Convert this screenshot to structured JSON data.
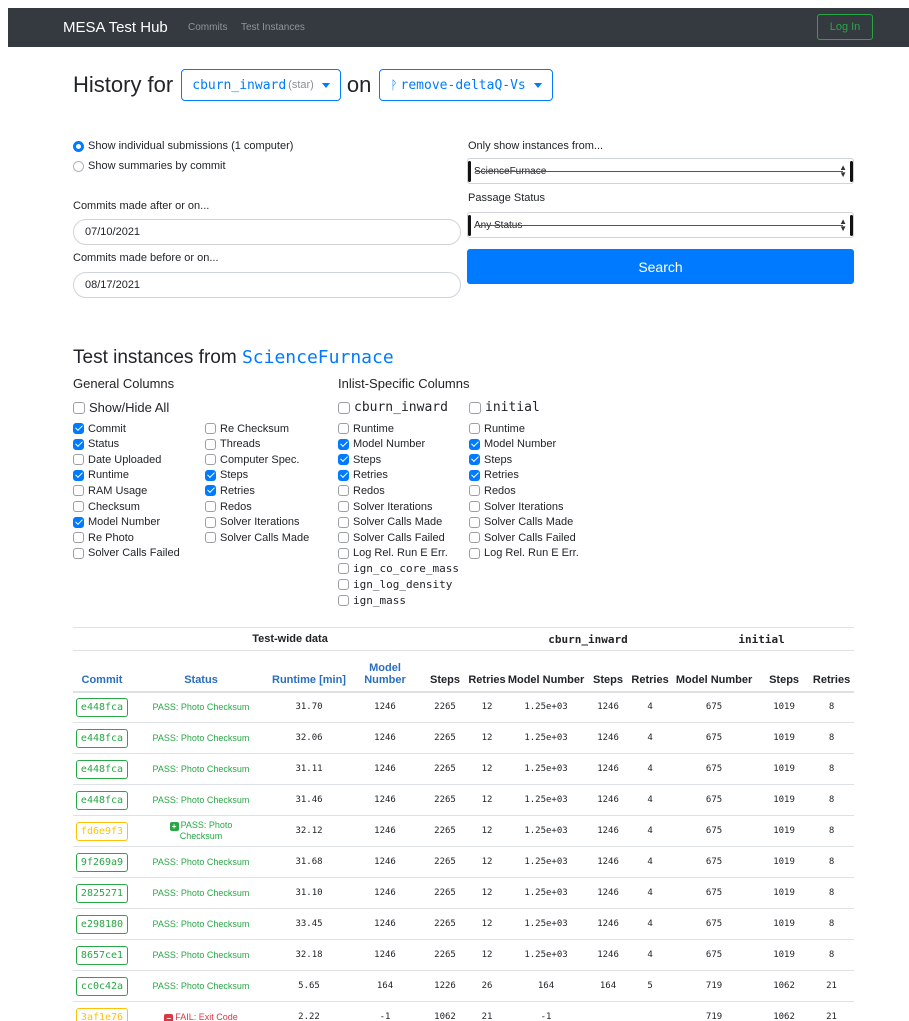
{
  "nav": {
    "brand": "MESA Test Hub",
    "links": [
      "Commits",
      "Test Instances"
    ],
    "login": "Log In"
  },
  "history": {
    "prefix": "History for",
    "test": "cburn_inward",
    "test_sub": "(star)",
    "on": "on",
    "branch": "remove-deltaQ-Vs"
  },
  "form": {
    "radio1": "Show individual submissions (1 computer)",
    "radio2": "Show summaries by commit",
    "after_label": "Commits made after or on...",
    "after_value": "07/10/2021",
    "before_label": "Commits made before or on...",
    "before_value": "08/17/2021",
    "instances_label": "Only show instances from...",
    "instances_value": "ScienceFurnace",
    "status_label": "Passage Status",
    "status_value": "Any Status",
    "search": "Search"
  },
  "instances": {
    "title": "Test instances from",
    "computer": "ScienceFurnace",
    "general_title": "General Columns",
    "inlist_title": "Inlist-Specific Columns",
    "show_hide": "Show/Hide All",
    "general_left": [
      {
        "label": "Commit",
        "checked": true
      },
      {
        "label": "Status",
        "checked": true
      },
      {
        "label": "Date Uploaded",
        "checked": false
      },
      {
        "label": "Runtime",
        "checked": true
      },
      {
        "label": "RAM Usage",
        "checked": false
      },
      {
        "label": "Checksum",
        "checked": false
      },
      {
        "label": "Model Number",
        "checked": true
      },
      {
        "label": "Re Photo",
        "checked": false
      },
      {
        "label": "Solver Calls Failed",
        "checked": false
      }
    ],
    "general_right": [
      {
        "label": "Re Checksum",
        "checked": false
      },
      {
        "label": "Threads",
        "checked": false
      },
      {
        "label": "Computer Spec.",
        "checked": false
      },
      {
        "label": "Steps",
        "checked": true
      },
      {
        "label": "Retries",
        "checked": true
      },
      {
        "label": "Redos",
        "checked": false
      },
      {
        "label": "Solver Iterations",
        "checked": false
      },
      {
        "label": "Solver Calls Made",
        "checked": false
      }
    ],
    "inlist1_name": "cburn_inward",
    "inlist1": [
      {
        "label": "Runtime",
        "checked": false
      },
      {
        "label": "Model Number",
        "checked": true
      },
      {
        "label": "Steps",
        "checked": true
      },
      {
        "label": "Retries",
        "checked": true
      },
      {
        "label": "Redos",
        "checked": false
      },
      {
        "label": "Solver Iterations",
        "checked": false
      },
      {
        "label": "Solver Calls Made",
        "checked": false
      },
      {
        "label": "Solver Calls Failed",
        "checked": false
      },
      {
        "label": "Log Rel. Run E Err.",
        "checked": false
      },
      {
        "label": "ign_co_core_mass",
        "checked": false,
        "mono": true
      },
      {
        "label": "ign_log_density",
        "checked": false,
        "mono": true
      },
      {
        "label": "ign_mass",
        "checked": false,
        "mono": true
      }
    ],
    "inlist2_name": "initial",
    "inlist2": [
      {
        "label": "Runtime",
        "checked": false
      },
      {
        "label": "Model Number",
        "checked": true
      },
      {
        "label": "Steps",
        "checked": true
      },
      {
        "label": "Retries",
        "checked": true
      },
      {
        "label": "Redos",
        "checked": false
      },
      {
        "label": "Solver Iterations",
        "checked": false
      },
      {
        "label": "Solver Calls Made",
        "checked": false
      },
      {
        "label": "Solver Calls Failed",
        "checked": false
      },
      {
        "label": "Log Rel. Run E Err.",
        "checked": false
      }
    ]
  },
  "table": {
    "groups": [
      "Test-wide data",
      "cburn_inward",
      "initial"
    ],
    "headers": [
      "Commit",
      "Status",
      "Runtime [min]",
      "Model Number",
      "Steps",
      "Retries",
      "Model Number",
      "Steps",
      "Retries",
      "Model Number",
      "Steps",
      "Retries"
    ],
    "rows": [
      {
        "commit": "e448fca",
        "state": "pass",
        "status": "PASS: Photo Checksum",
        "icon": false,
        "cells": [
          "31.70",
          "1246",
          "2265",
          "12",
          "1.25e+03",
          "1246",
          "4",
          "675",
          "1019",
          "8"
        ]
      },
      {
        "commit": "e448fca",
        "state": "pass",
        "status": "PASS: Photo Checksum",
        "icon": false,
        "cells": [
          "32.06",
          "1246",
          "2265",
          "12",
          "1.25e+03",
          "1246",
          "4",
          "675",
          "1019",
          "8"
        ]
      },
      {
        "commit": "e448fca",
        "state": "pass",
        "status": "PASS: Photo Checksum",
        "icon": false,
        "cells": [
          "31.11",
          "1246",
          "2265",
          "12",
          "1.25e+03",
          "1246",
          "4",
          "675",
          "1019",
          "8"
        ]
      },
      {
        "commit": "e448fca",
        "state": "pass",
        "status": "PASS: Photo Checksum",
        "icon": false,
        "cells": [
          "31.46",
          "1246",
          "2265",
          "12",
          "1.25e+03",
          "1246",
          "4",
          "675",
          "1019",
          "8"
        ]
      },
      {
        "commit": "fd6e9f3",
        "state": "warn",
        "status": "PASS: Photo Checksum",
        "icon": "plus",
        "cells": [
          "32.12",
          "1246",
          "2265",
          "12",
          "1.25e+03",
          "1246",
          "4",
          "675",
          "1019",
          "8"
        ]
      },
      {
        "commit": "9f269a9",
        "state": "pass",
        "status": "PASS: Photo Checksum",
        "icon": false,
        "cells": [
          "31.68",
          "1246",
          "2265",
          "12",
          "1.25e+03",
          "1246",
          "4",
          "675",
          "1019",
          "8"
        ]
      },
      {
        "commit": "2825271",
        "state": "pass",
        "status": "PASS: Photo Checksum",
        "icon": false,
        "cells": [
          "31.10",
          "1246",
          "2265",
          "12",
          "1.25e+03",
          "1246",
          "4",
          "675",
          "1019",
          "8"
        ]
      },
      {
        "commit": "e298180",
        "state": "pass",
        "status": "PASS: Photo Checksum",
        "icon": false,
        "cells": [
          "33.45",
          "1246",
          "2265",
          "12",
          "1.25e+03",
          "1246",
          "4",
          "675",
          "1019",
          "8"
        ]
      },
      {
        "commit": "8657ce1",
        "state": "pass",
        "status": "PASS: Photo Checksum",
        "icon": false,
        "cells": [
          "32.18",
          "1246",
          "2265",
          "12",
          "1.25e+03",
          "1246",
          "4",
          "675",
          "1019",
          "8"
        ]
      },
      {
        "commit": "cc0c42a",
        "state": "pass",
        "status": "PASS: Photo Checksum",
        "icon": false,
        "cells": [
          "5.65",
          "164",
          "1226",
          "26",
          "164",
          "164",
          "5",
          "719",
          "1062",
          "21"
        ]
      },
      {
        "commit": "3af1e76",
        "state": "warn",
        "status": "FAIL: Exit Code",
        "icon": "minus",
        "cells": [
          "2.22",
          "-1",
          "1062",
          "21",
          "-1",
          "",
          "",
          "719",
          "1062",
          "21"
        ]
      }
    ]
  },
  "colors": {
    "navbar": "#343a40",
    "primary": "#007bff",
    "success": "#28a745",
    "warning": "#ffc107",
    "danger": "#dc3545"
  }
}
